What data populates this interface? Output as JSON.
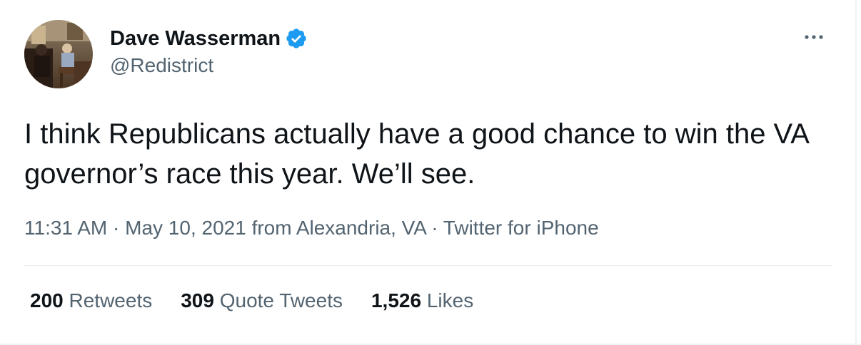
{
  "author": {
    "display_name": "Dave Wasserman",
    "handle": "@Redistrict",
    "verified": true
  },
  "tweet": {
    "text": "I think Republicans actually have a good chance to win the VA governor’s race this year. We’ll see."
  },
  "meta": {
    "time": "11:31 AM",
    "separator": "·",
    "date": "May 10, 2021",
    "from_label": "from",
    "location": "Alexandria, VA",
    "source": "Twitter for iPhone"
  },
  "stats": {
    "retweets_count": "200",
    "retweets_label": "Retweets",
    "quotes_count": "309",
    "quotes_label": "Quote Tweets",
    "likes_count": "1,526",
    "likes_label": "Likes"
  },
  "icons": {
    "verified": "verified-badge-icon",
    "more": "more-horizontal-icon"
  },
  "colors": {
    "text_primary": "#0f1419",
    "text_secondary": "#536471",
    "verified_blue": "#1d9bf0",
    "divider": "#e6ecf0"
  }
}
